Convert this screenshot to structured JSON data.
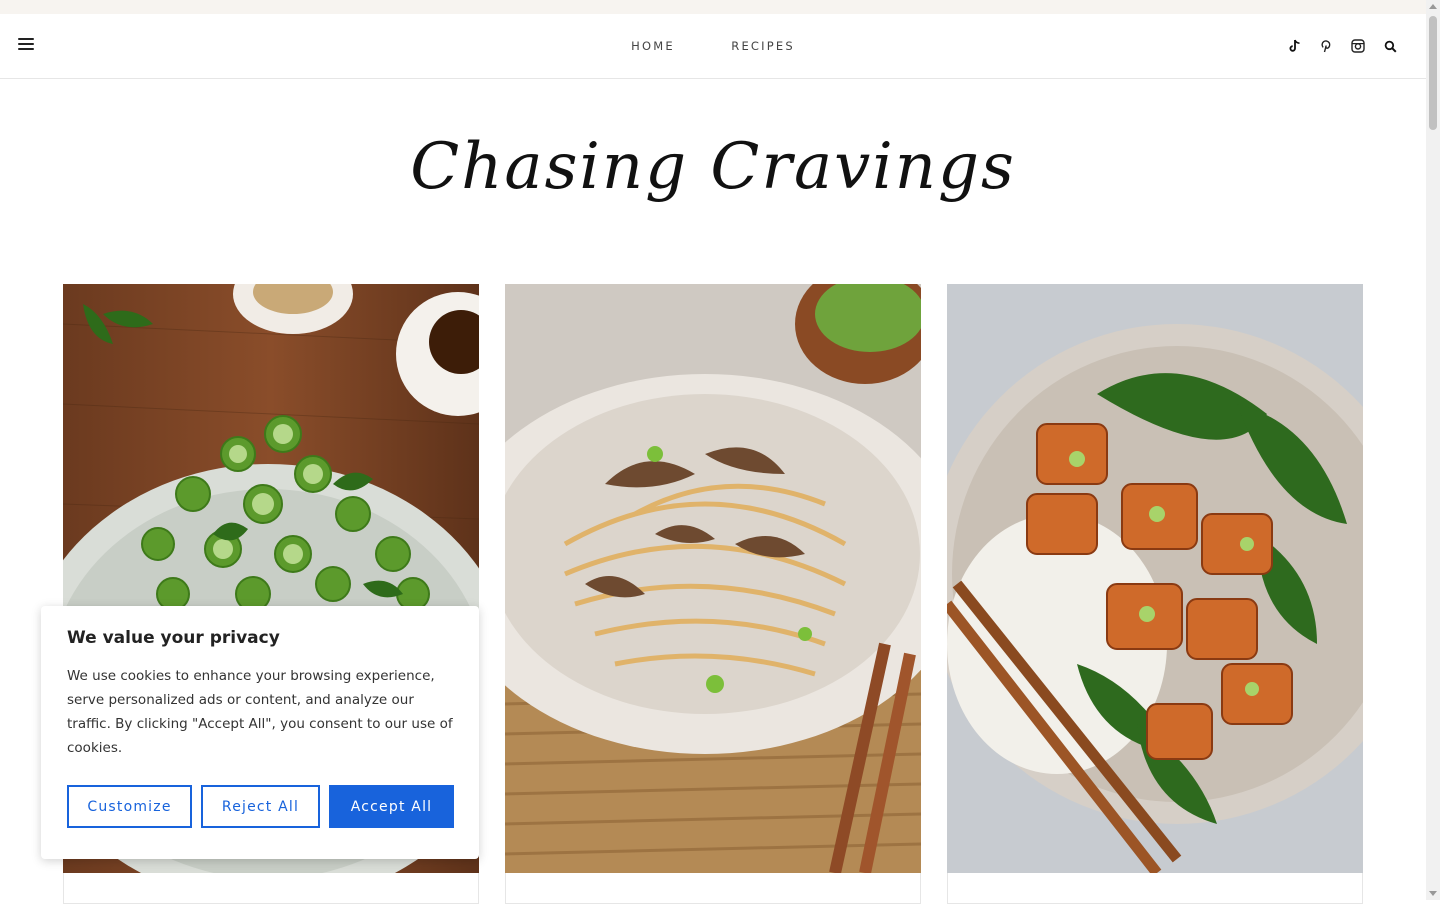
{
  "header": {
    "nav": [
      {
        "label": "HOME"
      },
      {
        "label": "RECIPES"
      }
    ],
    "social_icons": [
      "tiktok-icon",
      "pinterest-icon",
      "instagram-icon",
      "search-icon"
    ]
  },
  "brand": {
    "title": "Chasing Cravings"
  },
  "cards": [
    {
      "image": "cucumber-salad-photo"
    },
    {
      "image": "mushroom-noodles-photo"
    },
    {
      "image": "salmon-rice-bowl-photo"
    }
  ],
  "cookie_banner": {
    "title": "We value your privacy",
    "body": "We use cookies to enhance your browsing experience, serve personalized ads or content, and analyze our traffic. By clicking \"Accept All\", you consent to our use of cookies.",
    "customize_label": "Customize",
    "reject_label": "Reject All",
    "accept_label": "Accept All"
  },
  "colors": {
    "accent": "#1863dc",
    "top_strip": "#f7f4f0"
  }
}
